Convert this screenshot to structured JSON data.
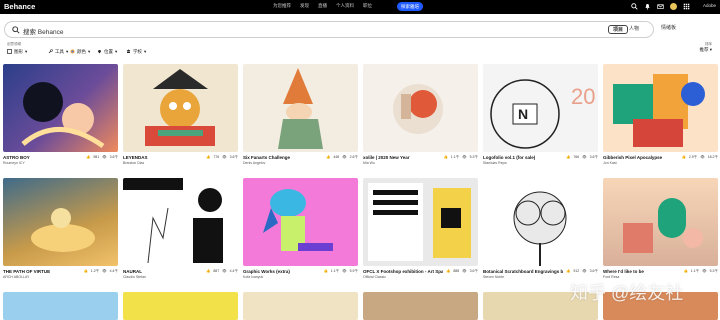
{
  "header": {
    "logo": "Behance",
    "nav": [
      "为您推荐",
      "发现",
      "直播",
      "个人资料",
      "职位"
    ],
    "cta": "探索雅培",
    "adobe": "Adobe"
  },
  "search": {
    "placeholder": "搜索 Behance",
    "tabs": [
      "项目",
      "人物",
      "情绪板"
    ],
    "active_tab": "项目"
  },
  "filters": {
    "label": "创意领域",
    "items": [
      "图形",
      "工具",
      "颜色",
      "位置",
      "学校"
    ],
    "sort_label": "排序",
    "sort_value": "推荐"
  },
  "cards": [
    {
      "title": "ASTRO BOY",
      "author": "Roumeyn ICY",
      "likes": "981",
      "views": "3.6千"
    },
    {
      "title": "LEYENDAS",
      "author": "Brandon Diaz",
      "likes": "776",
      "views": "3.6千"
    },
    {
      "title": "Six Fanarts Challenge",
      "author": "Denis Angelov",
      "likes": "448",
      "views": "2.6千"
    },
    {
      "title": "xolile | 2020 New Year",
      "author": "Mia Wu",
      "likes": "1.1千",
      "views": "5.3千"
    },
    {
      "title": "Logofolio vol.1 (for sale)",
      "author": "Stanislav Repa",
      "likes": "766",
      "views": "3.6千"
    },
    {
      "title": "Gibberish Pixel Apocalypse",
      "author": "Jon Kast",
      "likes": "2.9千",
      "views": "18.2千"
    },
    {
      "title": "THE PATH OF VIRTUE",
      "author": "ARCH ABOLLAY",
      "likes": "1.2千",
      "views": "4.4千"
    },
    {
      "title": "NAURAL",
      "author": "Claudiu Stefan",
      "likes": "887",
      "views": "4.4千"
    },
    {
      "title": "Graphic Works (extra)",
      "author": "Kofa Ivanyuk",
      "likes": "1.1千",
      "views": "5.9千"
    },
    {
      "title": "OFCL X Footshop exhibition - Art Space 3",
      "author": "Official Classic",
      "likes": "888",
      "views": "3.6千"
    },
    {
      "title": "Botanical Scratchboard Engravings by Steven Noble",
      "author": "Steven Noble",
      "likes": "912",
      "views": "3.6千"
    },
    {
      "title": "Where I'd like to be",
      "author": "Ford Resa",
      "likes": "1.1千",
      "views": "5.3千"
    }
  ],
  "watermark": "知乎 @绘友社",
  "colors": {
    "accent": "#1f5bff",
    "topbar": "#000000"
  }
}
